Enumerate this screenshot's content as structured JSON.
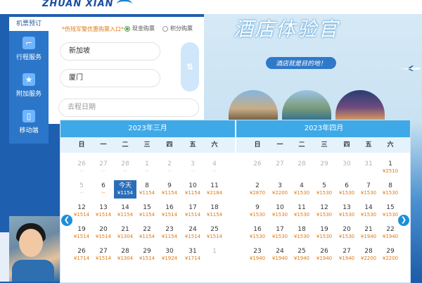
{
  "brand": {
    "logo_text": "ZHUAN XIAN"
  },
  "nav": {
    "header": "机票预订",
    "items": [
      {
        "label": "行程服务",
        "icon": "seat-icon"
      },
      {
        "label": "附加服务",
        "icon": "star-icon"
      },
      {
        "label": "移动端",
        "icon": "phone-icon"
      }
    ]
  },
  "form": {
    "coupon_link": "*伤残军警优惠购票入口*",
    "radio_cash": "现金购票",
    "radio_points": "积分购票",
    "from_city": "新加坡",
    "to_city": "厦门",
    "date_placeholder": "去程日期"
  },
  "promo": {
    "title": "酒店体验官",
    "subtitle": "酒店就是目的地！"
  },
  "calendar": {
    "weekdays": [
      "日",
      "一",
      "二",
      "三",
      "四",
      "五",
      "六"
    ],
    "months": [
      {
        "title": "2023年三月",
        "rows": [
          [
            [
              "26",
              "--",
              1
            ],
            [
              "27",
              "--",
              1
            ],
            [
              "28",
              "--",
              1
            ],
            [
              "1",
              "--",
              1
            ],
            [
              "2",
              "--",
              1
            ],
            [
              "3",
              "--",
              1
            ],
            [
              "4",
              "--",
              1
            ]
          ],
          [
            [
              "5",
              "--",
              1
            ],
            [
              "6",
              "--",
              0
            ],
            [
              "今天",
              "¥1154",
              2
            ],
            [
              "8",
              "¥1154",
              0
            ],
            [
              "9",
              "¥1154",
              0
            ],
            [
              "10",
              "¥1154",
              0
            ],
            [
              "11",
              "¥2184",
              0
            ]
          ],
          [
            [
              "12",
              "¥1514",
              0
            ],
            [
              "13",
              "¥1514",
              0
            ],
            [
              "14",
              "¥1154",
              0
            ],
            [
              "15",
              "¥1154",
              0
            ],
            [
              "16",
              "¥1514",
              0
            ],
            [
              "17",
              "¥1514",
              0
            ],
            [
              "18",
              "¥1154",
              0
            ]
          ],
          [
            [
              "19",
              "¥1514",
              0
            ],
            [
              "20",
              "¥1514",
              0
            ],
            [
              "21",
              "¥1304",
              0
            ],
            [
              "22",
              "¥1154",
              0
            ],
            [
              "23",
              "¥1154",
              0
            ],
            [
              "24",
              "¥1514",
              0
            ],
            [
              "25",
              "¥1514",
              0
            ]
          ],
          [
            [
              "26",
              "¥1714",
              0
            ],
            [
              "27",
              "¥1514",
              0
            ],
            [
              "28",
              "¥1304",
              0
            ],
            [
              "29",
              "¥1514",
              0
            ],
            [
              "30",
              "¥1924",
              0
            ],
            [
              "31",
              "¥1714",
              0
            ],
            [
              "1",
              "",
              1
            ]
          ]
        ]
      },
      {
        "title": "2023年四月",
        "rows": [
          [
            [
              "26",
              "",
              1
            ],
            [
              "27",
              "",
              1
            ],
            [
              "28",
              "",
              1
            ],
            [
              "29",
              "",
              1
            ],
            [
              "30",
              "",
              1
            ],
            [
              "31",
              "",
              1
            ],
            [
              "1",
              "¥2510",
              0
            ]
          ],
          [
            [
              "2",
              "¥2870",
              0
            ],
            [
              "3",
              "¥2200",
              0
            ],
            [
              "4",
              "¥1530",
              0
            ],
            [
              "5",
              "¥1530",
              0
            ],
            [
              "6",
              "¥1530",
              0
            ],
            [
              "7",
              "¥1530",
              0
            ],
            [
              "8",
              "¥1530",
              0
            ]
          ],
          [
            [
              "9",
              "¥1530",
              0
            ],
            [
              "10",
              "¥1530",
              0
            ],
            [
              "11",
              "¥1530",
              0
            ],
            [
              "12",
              "¥1530",
              0
            ],
            [
              "13",
              "¥1530",
              0
            ],
            [
              "14",
              "¥1530",
              0
            ],
            [
              "15",
              "¥1530",
              0
            ]
          ],
          [
            [
              "16",
              "¥1530",
              0
            ],
            [
              "17",
              "¥1530",
              0
            ],
            [
              "18",
              "¥1530",
              0
            ],
            [
              "19",
              "¥1530",
              0
            ],
            [
              "20",
              "¥1530",
              0
            ],
            [
              "21",
              "¥1940",
              0
            ],
            [
              "22",
              "¥1940",
              0
            ]
          ],
          [
            [
              "23",
              "¥1940",
              0
            ],
            [
              "24",
              "¥1940",
              0
            ],
            [
              "25",
              "¥1940",
              0
            ],
            [
              "26",
              "¥1940",
              0
            ],
            [
              "27",
              "¥1940",
              0
            ],
            [
              "28",
              "¥2200",
              0
            ],
            [
              "29",
              "¥2200",
              0
            ]
          ]
        ]
      }
    ]
  },
  "colors": {
    "accent": "#3fa9e8",
    "price": "#e07a14",
    "today": "#2b6eb7",
    "nav": "#2b76c8"
  }
}
